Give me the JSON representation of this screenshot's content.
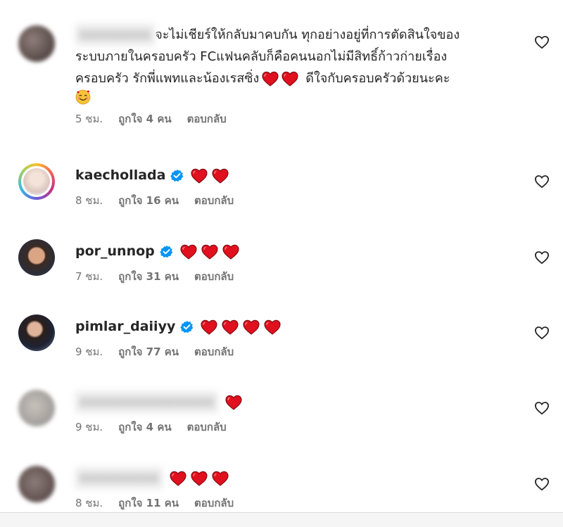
{
  "comments": [
    {
      "username": "xxxxxxxxx",
      "username_blurred": true,
      "text_lines": [
        "จะไม่เชียร์ให้กลับมาคบกัน ทุกอย่างอยู่ที่การตัดสินใจของ",
        "ระบบภายในครอบครัว FCแฟนคลับก็คือคนนอกไม่มีสิทธิ์ก้าวก่ายเรื่อง",
        "ครอบครัว รักพี่แพทและน้องเรสซิ่ง"
      ],
      "text_tail": "ดีใจกับครอบครัวด้วยนะคะ",
      "hearts_in_text": 2,
      "time": "5 ชม.",
      "likes": "ถูกใจ 4 คน",
      "reply": "ตอบกลับ"
    },
    {
      "username": "kaechollada",
      "verified": true,
      "hearts": 2,
      "time": "8 ชม.",
      "likes": "ถูกใจ 16 คน",
      "reply": "ตอบกลับ"
    },
    {
      "username": "por_unnop",
      "verified": true,
      "hearts": 3,
      "time": "7 ชม.",
      "likes": "ถูกใจ 31 คน",
      "reply": "ตอบกลับ"
    },
    {
      "username": "pimlar_daiiyy",
      "verified": true,
      "hearts": 4,
      "time": "9 ชม.",
      "likes": "ถูกใจ 77 คน",
      "reply": "ตอบกลับ"
    },
    {
      "username": "xxxxxxxxxxxxxxxxx",
      "username_blurred": true,
      "hearts": 1,
      "time": "9 ชม.",
      "likes": "ถูกใจ 4 คน",
      "reply": "ตอบกลับ"
    },
    {
      "username": "xxxxxxxxxx",
      "username_blurred": true,
      "hearts": 3,
      "time": "8 ชม.",
      "likes": "ถูกใจ 11 คน",
      "reply": "ตอบกลับ"
    }
  ],
  "colors": {
    "heart": "#e0101e",
    "verified": "#0095f6",
    "meta": "#737373",
    "text": "#262626"
  },
  "icons": {
    "like": "heart-outline-icon",
    "verified": "verified-badge-icon",
    "emoji": "smiling-face-with-hearts-icon"
  }
}
